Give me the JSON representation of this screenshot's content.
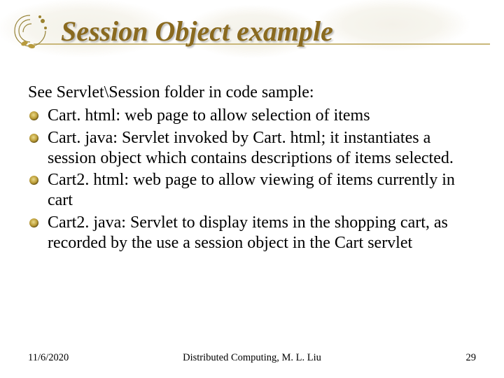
{
  "title": "Session Object example",
  "intro": "See Servlet\\Session folder in code sample:",
  "bullets": [
    "Cart. html: web page to allow selection of items",
    "Cart. java: Servlet invoked by Cart. html; it instantiates a session object which contains descriptions of items selected.",
    "Cart2. html: web page to allow viewing of items currently in cart",
    "Cart2. java: Servlet to display items in the shopping cart, as recorded by the use a session object in the Cart servlet"
  ],
  "footer": {
    "date": "11/6/2020",
    "center": "Distributed Computing, M. L. Liu",
    "page": "29"
  }
}
